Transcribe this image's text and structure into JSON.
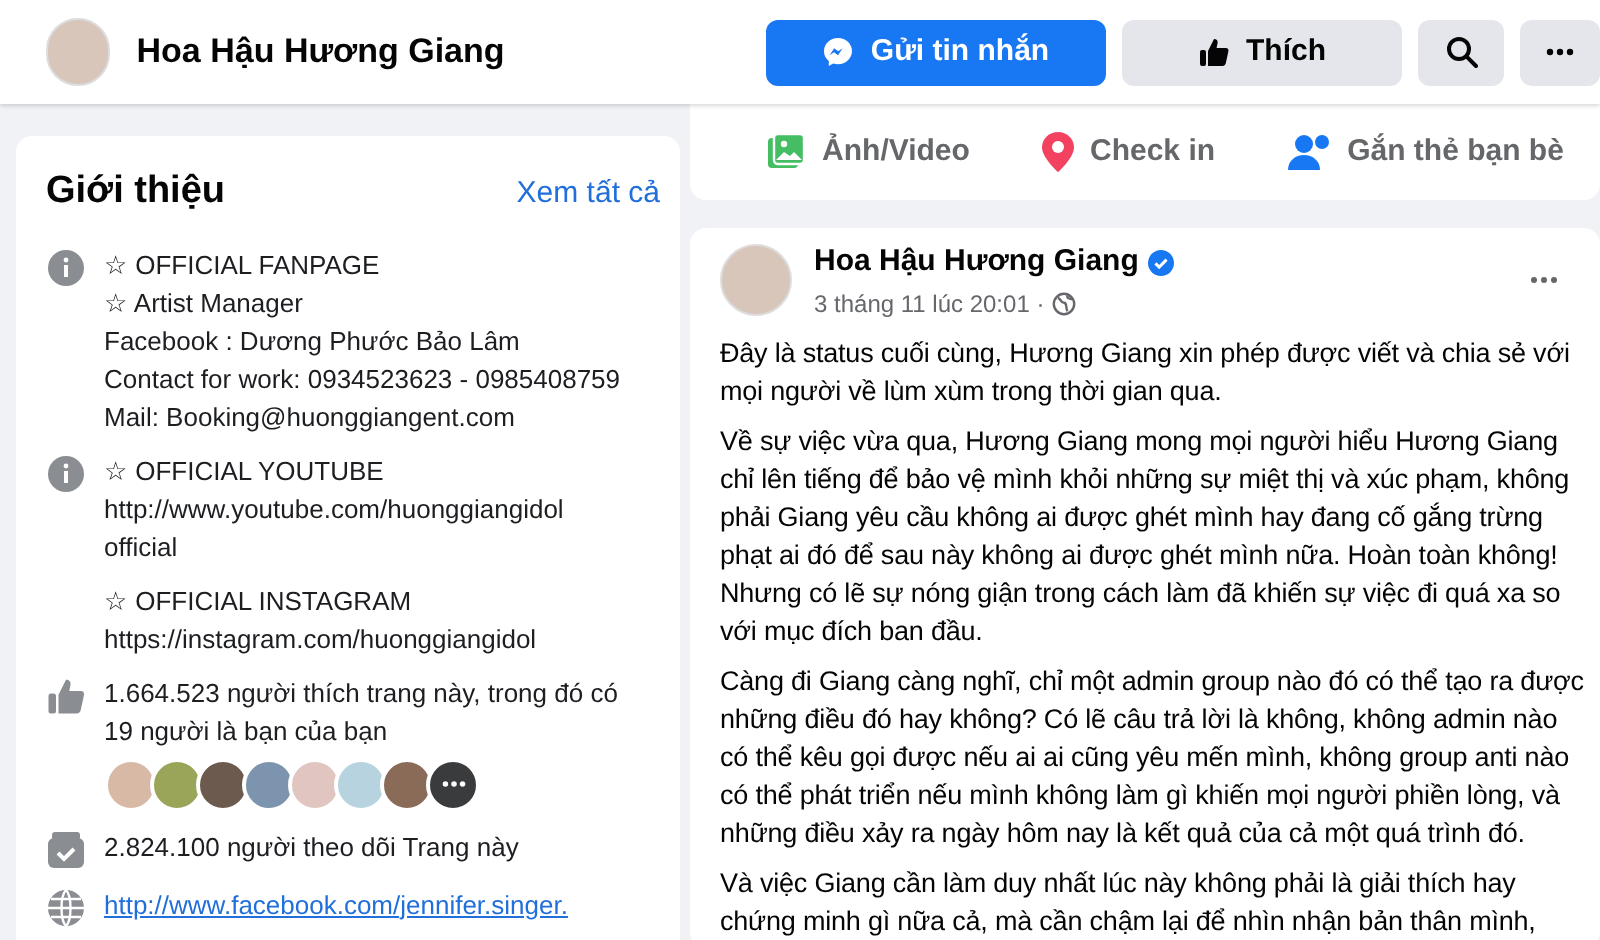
{
  "header": {
    "page_name": "Hoa Hậu Hương Giang",
    "buttons": [
      {
        "kind": "message",
        "label": "Gửi tin nhắn"
      },
      {
        "kind": "like",
        "label": "Thích"
      },
      {
        "kind": "search"
      },
      {
        "kind": "more"
      }
    ]
  },
  "composer_actions": [
    {
      "kind": "photo",
      "label": "Ảnh/Video"
    },
    {
      "kind": "checkin",
      "label": "Check in"
    },
    {
      "kind": "tag",
      "label": "Gắn thẻ bạn bè"
    }
  ],
  "intro": {
    "title": "Giới thiệu",
    "see_all": "Xem tất cả",
    "items": [
      {
        "kind": "info",
        "lines": [
          "☆ OFFICIAL FANPAGE",
          "☆ Artist Manager",
          "Facebook : Dương Phước Bảo Lâm",
          "Contact for work: 0934523623 - 0985408759",
          "Mail: Booking@huonggiangent.com"
        ]
      },
      {
        "kind": "info",
        "lines": [
          "☆ OFFICIAL YOUTUBE",
          "http://www.youtube.com/huonggiangidol official"
        ]
      },
      {
        "kind": "plain",
        "lines": [
          "☆ OFFICIAL INSTAGRAM",
          "https://instagram.com/huonggiangidol"
        ]
      },
      {
        "kind": "likes",
        "lines": [
          "1.664.523 người thích trang này, trong đó có 19 người là bạn của bạn"
        ]
      },
      {
        "kind": "followers",
        "lines": [
          "2.824.100 người theo dõi Trang này"
        ]
      },
      {
        "kind": "website",
        "lines": [
          "http://www.facebook.com/jennifer.singer."
        ]
      }
    ]
  },
  "post": {
    "author": "Hoa Hậu Hương Giang",
    "verified": true,
    "time": "3 tháng 11 lúc 20:01 ·",
    "paragraphs": [
      "Đây là status cuối cùng, Hương Giang xin phép được viết và chia sẻ với mọi người về lùm xùm trong thời gian qua.",
      "Về sự việc vừa qua, Hương Giang mong mọi người hiểu Hương Giang chỉ lên tiếng để bảo vệ mình khỏi những sự miệt thị và xúc phạm, không phải Giang yêu cầu không ai được ghét mình hay đang cố gắng trừng phạt ai đó để sau này không ai được ghét mình nữa. Hoàn toàn không! Nhưng có lẽ sự nóng giận trong cách làm đã khiến sự việc đi quá xa so với mục đích ban đầu.",
      "Càng đi Giang càng nghĩ, chỉ một admin group nào đó có thể tạo ra được những điều đó hay không? Có lẽ câu trả lời là không, không admin nào có thể kêu gọi được nếu ai ai cũng yêu mến mình, không group anti nào có thể phát triển nếu mình không làm gì khiến mọi người phiền lòng, và những điều xảy ra ngày hôm nay là kết quả của cả một quá trình đó.",
      "Và việc Giang cần làm duy nhất lúc này không phải là giải thích hay chứng minh gì nữa cả, mà cần chậm lại để nhìn nhận bản thân mình,"
    ]
  }
}
